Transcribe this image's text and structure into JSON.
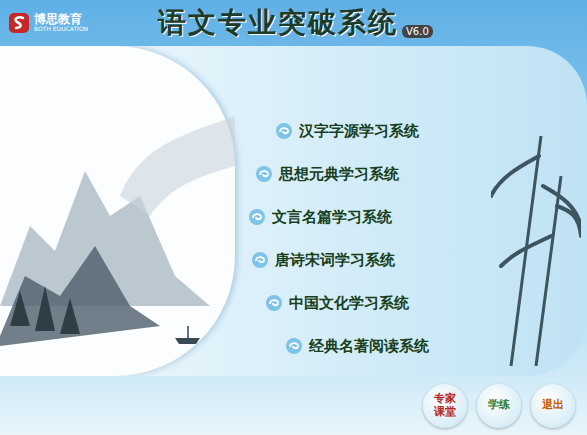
{
  "logo": {
    "name": "博思教育",
    "subtitle": "BOTH EDUCATION"
  },
  "title": "语文专业突破系统",
  "version": "V6.0",
  "menu": [
    {
      "label": "汉字字源学习系统"
    },
    {
      "label": "思想元典学习系统"
    },
    {
      "label": "文言名篇学习系统"
    },
    {
      "label": "唐诗宋词学习系统"
    },
    {
      "label": "中国文化学习系统"
    },
    {
      "label": "经典名著阅读系统"
    }
  ],
  "buttons": [
    {
      "label": "专家课堂",
      "color": "#b3261e"
    },
    {
      "label": "学练",
      "color": "#2e7d32"
    },
    {
      "label": "退出",
      "color": "#c25a00"
    }
  ]
}
